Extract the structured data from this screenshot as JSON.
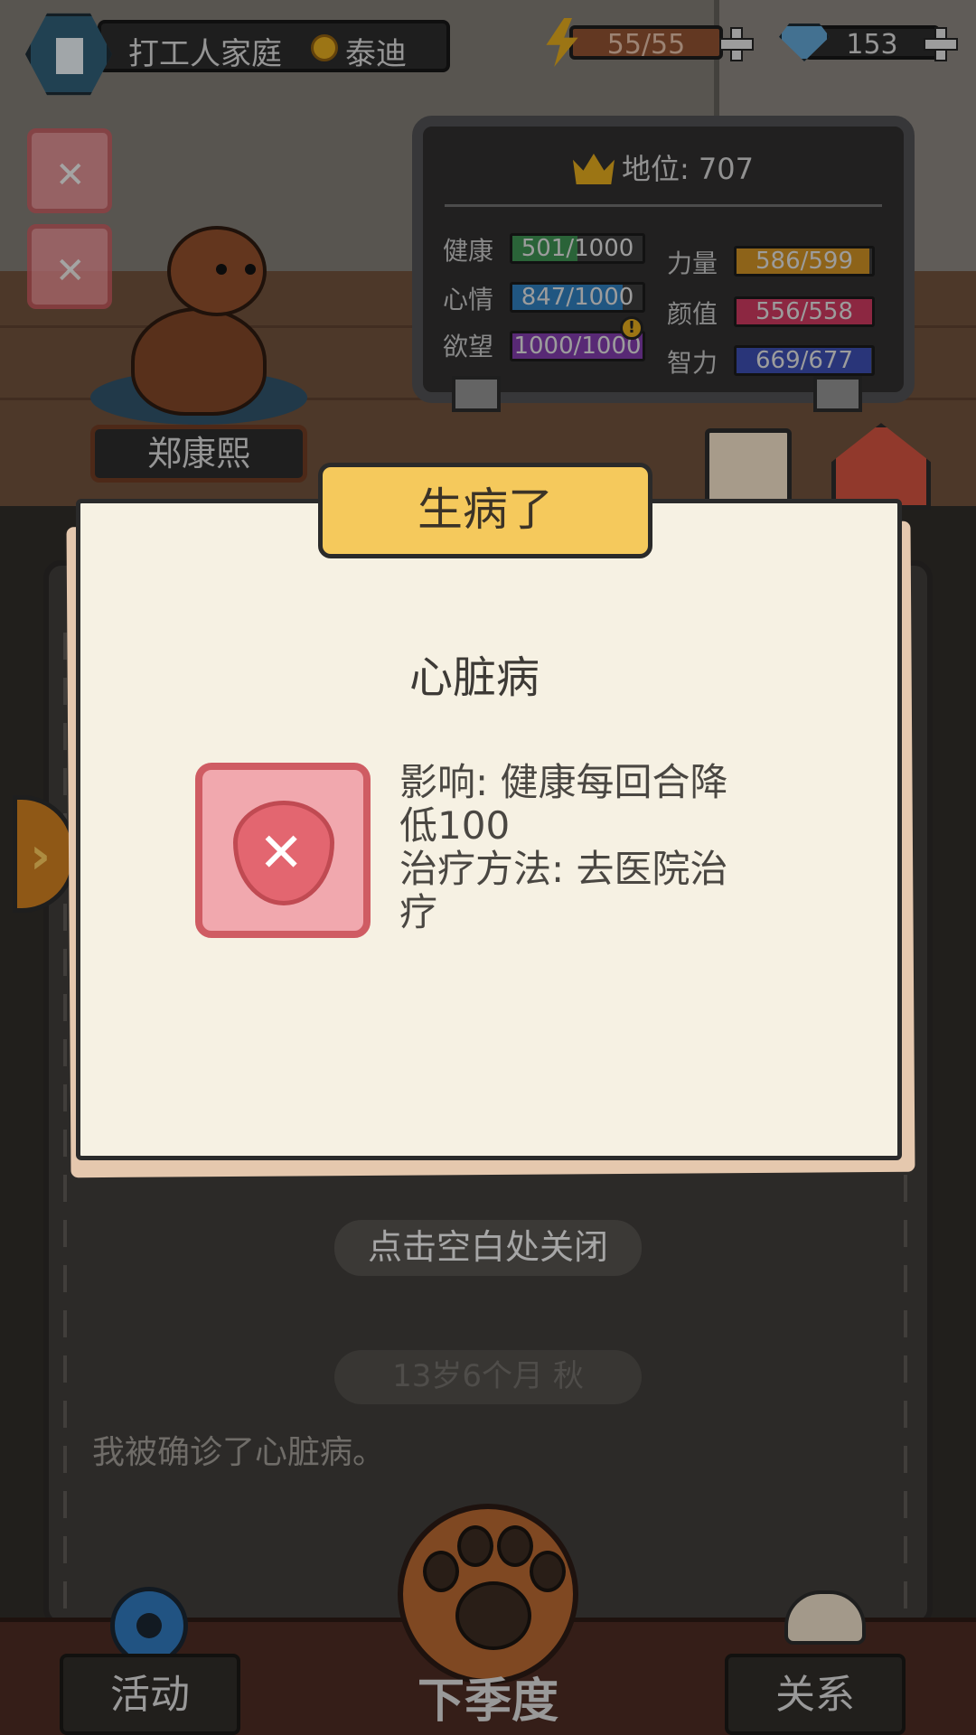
{
  "topbar": {
    "family_name": "打工人家庭",
    "family_title": "泰迪",
    "energy": "55/55",
    "gems": "153"
  },
  "pet": {
    "name": "郑康熙"
  },
  "status_board": {
    "title": "地位: 707",
    "stats": [
      {
        "label": "健康",
        "value": "501/1000",
        "fraction": 0.5,
        "color": "#3b8a4e"
      },
      {
        "label": "力量",
        "value": "586/599",
        "fraction": 0.98,
        "color": "#c48a23"
      },
      {
        "label": "心情",
        "value": "847/1000",
        "fraction": 0.85,
        "color": "#2d78b3"
      },
      {
        "label": "颜值",
        "value": "556/558",
        "fraction": 1.0,
        "color": "#c2375a"
      },
      {
        "label": "欲望",
        "value": "1000/1000",
        "fraction": 1.0,
        "color": "#7b3aa3"
      },
      {
        "label": "智力",
        "value": "669/677",
        "fraction": 0.99,
        "color": "#3a4aa8"
      }
    ]
  },
  "modal": {
    "header": "生病了",
    "disease_name": "心脏病",
    "effect": "影响: 健康每回合降低100",
    "treatment": "治疗方法: 去医院治疗"
  },
  "log": {
    "close_hint": "点击空白处关闭",
    "age": "13岁6个月 秋",
    "entry": "我被确诊了心脏病。"
  },
  "bottom_nav": {
    "activities": "活动",
    "next_season": "下季度",
    "relations": "关系"
  }
}
